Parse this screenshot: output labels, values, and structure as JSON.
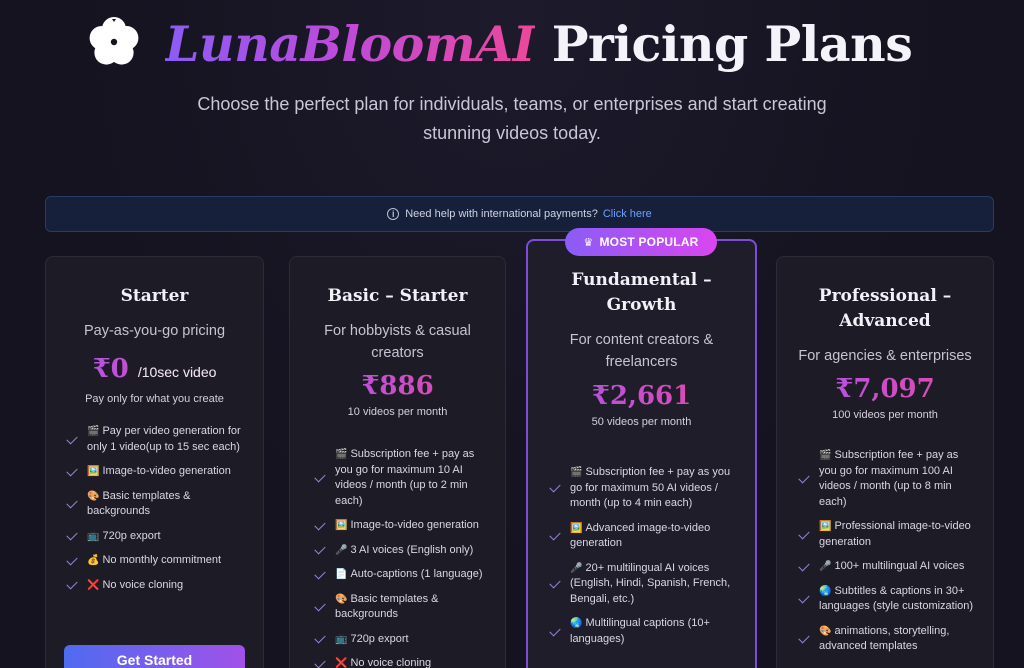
{
  "header": {
    "brand": "LunaBloomAI",
    "title_rest": "Pricing Plans",
    "subtitle": "Choose the perfect plan for individuals, teams, or enterprises and start creating stunning videos today."
  },
  "banner": {
    "text": "Need help with international payments?",
    "link": "Click here"
  },
  "badge": {
    "label": "MOST POPULAR"
  },
  "plans": [
    {
      "name": "Starter",
      "desc": "Pay-as-you-go pricing",
      "price": "₹0",
      "unit": "/10sec video",
      "note": "Pay only for what you create",
      "features": [
        {
          "icon": "🎬",
          "text": "Pay per video generation for only 1 video(up to 15 sec each)"
        },
        {
          "icon": "🖼️",
          "text": "Image-to-video generation"
        },
        {
          "icon": "🎨",
          "text": "Basic templates & backgrounds"
        },
        {
          "icon": "📺",
          "text": "720p export"
        },
        {
          "icon": "💰",
          "text": "No monthly commitment"
        },
        {
          "icon": "❌",
          "text": "No voice cloning"
        }
      ],
      "cta": "Get Started"
    },
    {
      "name": "Basic – Starter",
      "desc": "For hobbyists & casual creators",
      "price": "₹886",
      "note": "10 videos per month",
      "features": [
        {
          "icon": "🎬",
          "text": "Subscription fee + pay as you go for maximum 10 AI videos / month (up to 2 min each)"
        },
        {
          "icon": "🖼️",
          "text": "Image-to-video generation"
        },
        {
          "icon": "🎤",
          "text": "3 AI voices (English only)"
        },
        {
          "icon": "📄",
          "text": "Auto-captions (1 language)"
        },
        {
          "icon": "🎨",
          "text": "Basic templates & backgrounds"
        },
        {
          "icon": "📺",
          "text": "720p export"
        },
        {
          "icon": "❌",
          "text": "No voice cloning"
        }
      ]
    },
    {
      "name": "Fundamental – Growth",
      "desc": "For content creators & freelancers",
      "price": "₹2,661",
      "note": "50 videos per month",
      "features": [
        {
          "icon": "🎬",
          "text": "Subscription fee + pay as you go for maximum 50 AI videos / month (up to 4 min each)"
        },
        {
          "icon": "🖼️",
          "text": "Advanced image-to-video generation"
        },
        {
          "icon": "🎤",
          "text": "20+ multilingual AI voices (English, Hindi, Spanish, French, Bengali, etc.)"
        },
        {
          "icon": "🌏",
          "text": "Multilingual captions (10+ languages)"
        }
      ]
    },
    {
      "name": "Professional – Advanced",
      "desc": "For agencies & enterprises",
      "price": "₹7,097",
      "note": "100 videos per month",
      "features": [
        {
          "icon": "🎬",
          "text": "Subscription fee + pay as you go for maximum 100 AI videos / month (up to 8 min each)"
        },
        {
          "icon": "🖼️",
          "text": "Professional image-to-video generation"
        },
        {
          "icon": "🎤",
          "text": "100+ multilingual AI voices"
        },
        {
          "icon": "🌏",
          "text": "Subtitles & captions in 30+ languages (style customization)"
        },
        {
          "icon": "🎨",
          "text": "animations, storytelling, advanced templates"
        }
      ]
    }
  ]
}
